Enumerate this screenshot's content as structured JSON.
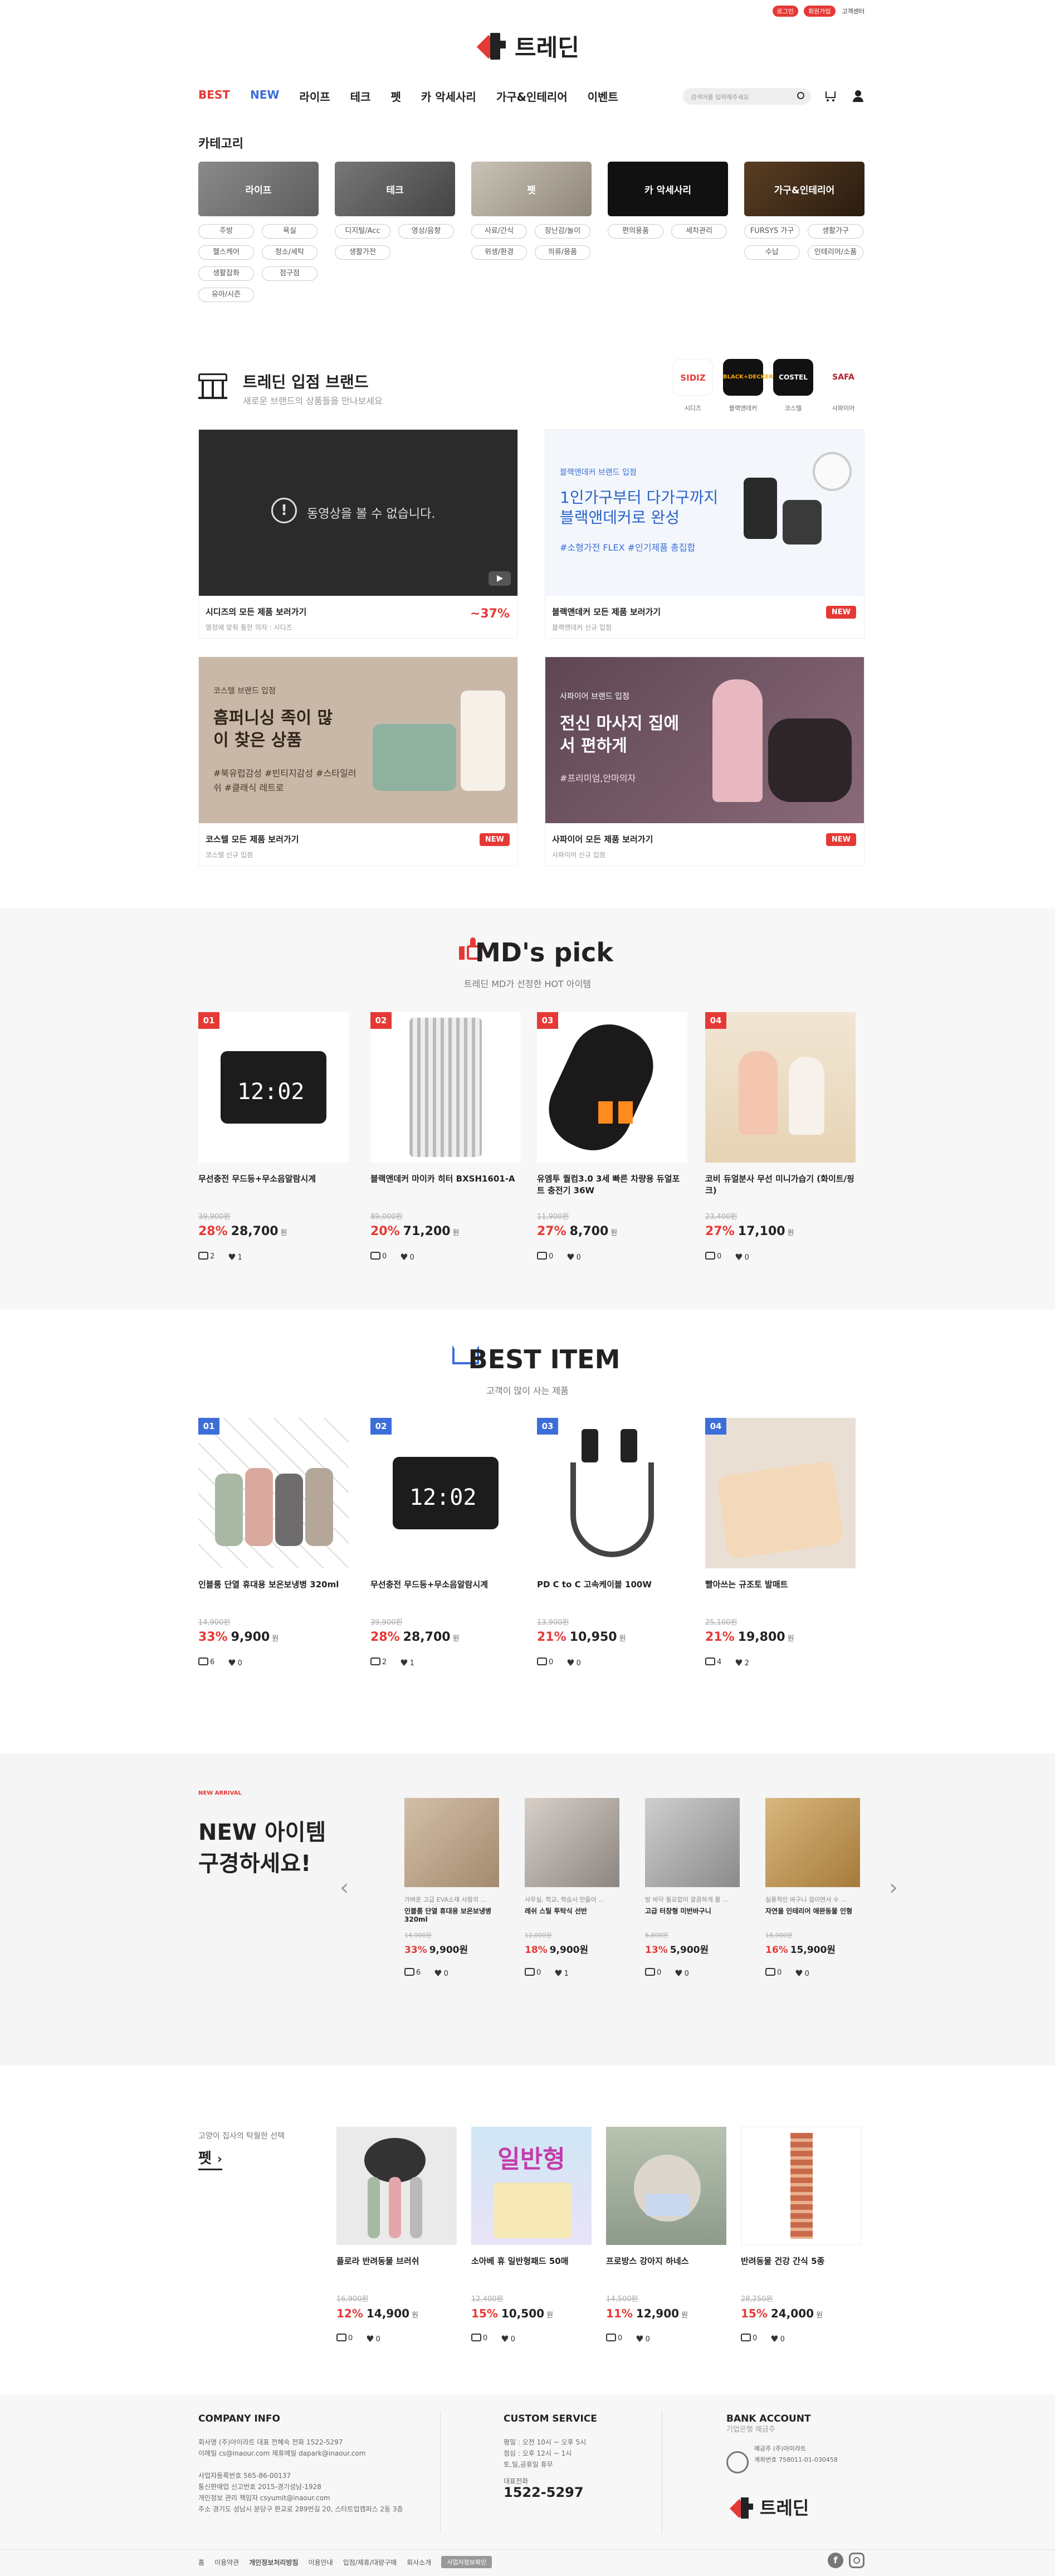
{
  "header": {
    "top_links": [
      "로그인",
      "회원가입",
      "고객센터"
    ],
    "logo_text": "트레딘",
    "gnb": [
      "BEST",
      "NEW",
      "라이프",
      "테크",
      "펫",
      "카 악세사리",
      "가구&인테리어",
      "이벤트"
    ],
    "search_placeholder": "검색어를 입력해주세요"
  },
  "category": {
    "title": "카테고리",
    "cards": [
      "라이프",
      "테크",
      "펫",
      "카 악세사리",
      "가구&인테리어"
    ],
    "subs": [
      [
        "주방",
        "욕실",
        "헬스케어",
        "청소/세탁",
        "생활잡화",
        "점구점",
        "유아/시즌"
      ],
      [
        "디지털/Acc",
        "영상/음향",
        "생활가전"
      ],
      [
        "사료/간식",
        "장난감/놀이",
        "위생/환경",
        "의류/용품"
      ],
      [
        "편의용품",
        "세차관리"
      ],
      [
        "FURSYS 가구",
        "생활가구",
        "수납",
        "인테리어/소품"
      ]
    ]
  },
  "brands": {
    "title": "트레딘 입점 브랜드",
    "subtitle": "새로운 브랜드의 상품들을 만나보세요",
    "logos": [
      {
        "mark": "SIDIZ",
        "name": "시디즈"
      },
      {
        "mark": "BLACK+DECKER",
        "name": "블랙앤데커"
      },
      {
        "mark": "COSTEL",
        "name": "코스텔"
      },
      {
        "mark": "SAFA",
        "name": "사파이어"
      }
    ],
    "panels": [
      {
        "video_msg": "동영상을 볼 수 없습니다.",
        "link": "시디즈의 모든 제품 보러가기",
        "desc": "열정에 맞춰 통한 의자 : 시디즈",
        "tag": "~37%"
      },
      {
        "banner_small": "블랙앤데커 브랜드 입점",
        "banner_big": "1인가구부터 다가구까지 블랙앤데커로 완성",
        "banner_tags": "#소형가전 FLEX #인기제품 총집합",
        "link": "블랙앤데커 모든 제품 보러가기",
        "desc": "블랙앤데커 신규 입점",
        "tag": "NEW"
      },
      {
        "banner_small": "코스텔 브랜드 입점",
        "banner_big": "흠퍼니싱 족이 많이 찾은 상품",
        "banner_tags": "#북유럽감성 #빈티지감성 #스타일러쉬 #클래식 레트로",
        "link": "코스텔 모든 제품 보러가기",
        "desc": "코스텔 신규 입점",
        "tag": "NEW"
      },
      {
        "banner_small": "사파이어 브랜드 입점",
        "banner_big": "전신 마사지 집에서 편하게",
        "banner_tags": "#프리미엄,안마의자",
        "link": "사파이어 모든 제품 보러가기",
        "desc": "사파이어 신규 입점",
        "tag": "NEW"
      }
    ]
  },
  "mdpick": {
    "title": "MD's pick",
    "subtitle": "트레딘 MD가 선정한 HOT 아이템",
    "items": [
      {
        "rank": "01",
        "name": "무선충전 무드등+무소음알람시계",
        "orig": "39,900원",
        "rate": "28%",
        "price": "28,700",
        "won": "원",
        "reviews": "2",
        "likes": "1"
      },
      {
        "rank": "02",
        "name": "블랙앤데커 마이카 히터 BXSH1601-A",
        "orig": "89,000원",
        "rate": "20%",
        "price": "71,200",
        "won": "원",
        "reviews": "0",
        "likes": "0"
      },
      {
        "rank": "03",
        "name": "유엠투 퀄컴3.0 3세 빠른 차량용 듀얼포트 충전기 36W",
        "orig": "11,900원",
        "rate": "27%",
        "price": "8,700",
        "won": "원",
        "reviews": "0",
        "likes": "0"
      },
      {
        "rank": "04",
        "name": "코비 듀얼분사 무선 미니가습기 (화이트/핑크)",
        "orig": "23,400원",
        "rate": "27%",
        "price": "17,100",
        "won": "원",
        "reviews": "0",
        "likes": "0"
      }
    ]
  },
  "best": {
    "title": "BEST ITEM",
    "subtitle": "고객이 많이 사는 제품",
    "items": [
      {
        "rank": "01",
        "name": "인블룸 단열 휴대용 보온보냉병 320ml",
        "orig": "14,900원",
        "rate": "33%",
        "price": "9,900",
        "won": "원",
        "reviews": "6",
        "likes": "0"
      },
      {
        "rank": "02",
        "name": "무선충전 무드등+무소음알람시계",
        "orig": "39,900원",
        "rate": "28%",
        "price": "28,700",
        "won": "원",
        "reviews": "2",
        "likes": "1"
      },
      {
        "rank": "03",
        "name": "PD C to C 고속케이블 100W",
        "orig": "13,900원",
        "rate": "21%",
        "price": "10,950",
        "won": "원",
        "reviews": "0",
        "likes": "0"
      },
      {
        "rank": "04",
        "name": "빨아쓰는 규조토 발매트",
        "orig": "25,100원",
        "rate": "21%",
        "price": "19,800",
        "won": "원",
        "reviews": "4",
        "likes": "2"
      }
    ]
  },
  "newitems": {
    "label": "NEW ARRIVAL",
    "heading": "NEW 아이템 구경하세요!",
    "items": [
      {
        "sub": "가벼운 고급 EVA소재 사람의 ...",
        "name": "인블룸 단열 휴대용 보온보냉병 320ml",
        "orig": "14,900원",
        "rate": "33%",
        "price": "9,900원",
        "reviews": "6",
        "likes": "0"
      },
      {
        "sub": "사무실, 학교, 학습시 만들어 ...",
        "name": "레쉬 스틸 투탁식 선반",
        "orig": "12,000원",
        "rate": "18%",
        "price": "9,900원",
        "reviews": "0",
        "likes": "1"
      },
      {
        "sub": "방 바닥 필요없이 깔끔하게 물 ...",
        "name": "고급 터창형 미반바구니",
        "orig": "6,800원",
        "rate": "13%",
        "price": "5,900원",
        "reviews": "0",
        "likes": "0"
      },
      {
        "sub": "실용적인 바구니 걸이면서 수 ...",
        "name": "자연을 인테리어 애완동물 인형",
        "orig": "18,900원",
        "rate": "16%",
        "price": "15,900원",
        "reviews": "0",
        "likes": "0"
      }
    ]
  },
  "pet": {
    "kicker": "고양이 집사의 탁월한 선택",
    "title": "펫",
    "items": [
      {
        "name": "플로라 반려동물 브러쉬",
        "orig": "16,900원",
        "rate": "12%",
        "price": "14,900",
        "won": "원",
        "reviews": "0",
        "likes": "0",
        "banner": ""
      },
      {
        "name": "소아베 휴 일반형패드 50매",
        "orig": "12,400원",
        "rate": "15%",
        "price": "10,500",
        "won": "원",
        "reviews": "0",
        "likes": "0",
        "banner": "일반형"
      },
      {
        "name": "프로방스 강아지 하네스",
        "orig": "14,500원",
        "rate": "11%",
        "price": "12,900",
        "won": "원",
        "reviews": "0",
        "likes": "0",
        "banner": ""
      },
      {
        "name": "반려동물 건강 간식 5종",
        "orig": "28,250원",
        "rate": "15%",
        "price": "24,000",
        "won": "원",
        "reviews": "0",
        "likes": "0",
        "banner": ""
      }
    ]
  },
  "footer": {
    "company_h": "COMPANY INFO",
    "company_lines": [
      "회사명 (주)아이라트  대표 전혜숙  전화 1522-5297",
      "이메일 cs@inaour.com  제휴메일 dapark@inaour.com",
      "",
      "사업자등록번호 565-86-00137",
      "통신판매업 신고번호 2015-경기성남-1928",
      "개인정보 관리 책임자 csyumit@inaour.com",
      "주소 경기도 성남시 분당구 판교로 289번길 20, 스타트업캠퍼스 2동 3층"
    ],
    "cs_h": "CUSTOM SERVICE",
    "cs_lines": [
      "평일 : 오전 10시 ~ 오후 5시",
      "점심 : 오후 12시 ~ 1시",
      "토,일,공휴일 휴무",
      "대표전화"
    ],
    "cs_phone": "1522-5297",
    "bank_h": "BANK ACCOUNT",
    "bank_sub": "기업은행 예금주",
    "bank_lines": [
      "예금주 (주)아이라트",
      "계좌번호 758011-01-030458"
    ],
    "logo_text": "트레딘",
    "bottom_links": [
      "홈",
      "이용약관",
      "개인정보처리방침",
      "이용안내",
      "입점/제휴/대량구매",
      "회사소개"
    ],
    "family_site": "사업자정보확인"
  },
  "colors": {
    "accent": "#e53935",
    "blue": "#3b6ed8",
    "dark": "#222222"
  }
}
